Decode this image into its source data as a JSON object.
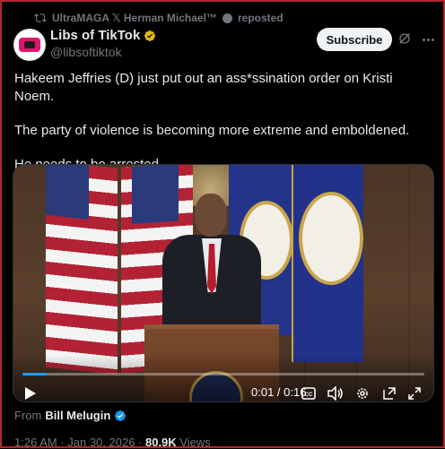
{
  "repost": {
    "text": "UltraMAGA 𝕏 Herman Michael™",
    "suffix": "reposted"
  },
  "author": {
    "display_name": "Libs of TikTok",
    "handle": "@libsoftiktok"
  },
  "actions": {
    "subscribe_label": "Subscribe"
  },
  "tweet": {
    "paragraphs": [
      "Hakeem Jeffries (D) just put out an ass*ssination order on Kristi Noem.",
      "The party of violence is becoming more extreme and emboldened.",
      "He needs to be arrested."
    ]
  },
  "video": {
    "time_label": "0:01 / 0:16",
    "progress_fraction": 0.06
  },
  "attribution": {
    "from_label": "From",
    "from_name": "Bill Melugin"
  },
  "meta": {
    "timestamp": "1:26 AM · Jan 30, 2026 · ",
    "views_count": "80.9K",
    "views_label": " Views"
  },
  "colors": {
    "accent": "#1d9bf0",
    "gold_badge": "#e2b719",
    "subscribe_bg": "#eff3f4",
    "frame": "#b3262b"
  }
}
